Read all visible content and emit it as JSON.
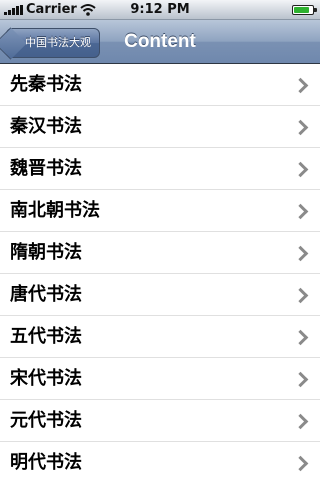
{
  "status_bar": {
    "carrier": "Carrier",
    "time": "9:12 PM",
    "battery_level": 0.85
  },
  "nav_bar": {
    "back_label": "中国书法大观",
    "title": "Content"
  },
  "list": {
    "items": [
      {
        "label": "先秦书法"
      },
      {
        "label": "秦汉书法"
      },
      {
        "label": "魏晋书法"
      },
      {
        "label": "南北朝书法"
      },
      {
        "label": "隋朝书法"
      },
      {
        "label": "唐代书法"
      },
      {
        "label": "五代书法"
      },
      {
        "label": "宋代书法"
      },
      {
        "label": "元代书法"
      },
      {
        "label": "明代书法"
      }
    ]
  }
}
